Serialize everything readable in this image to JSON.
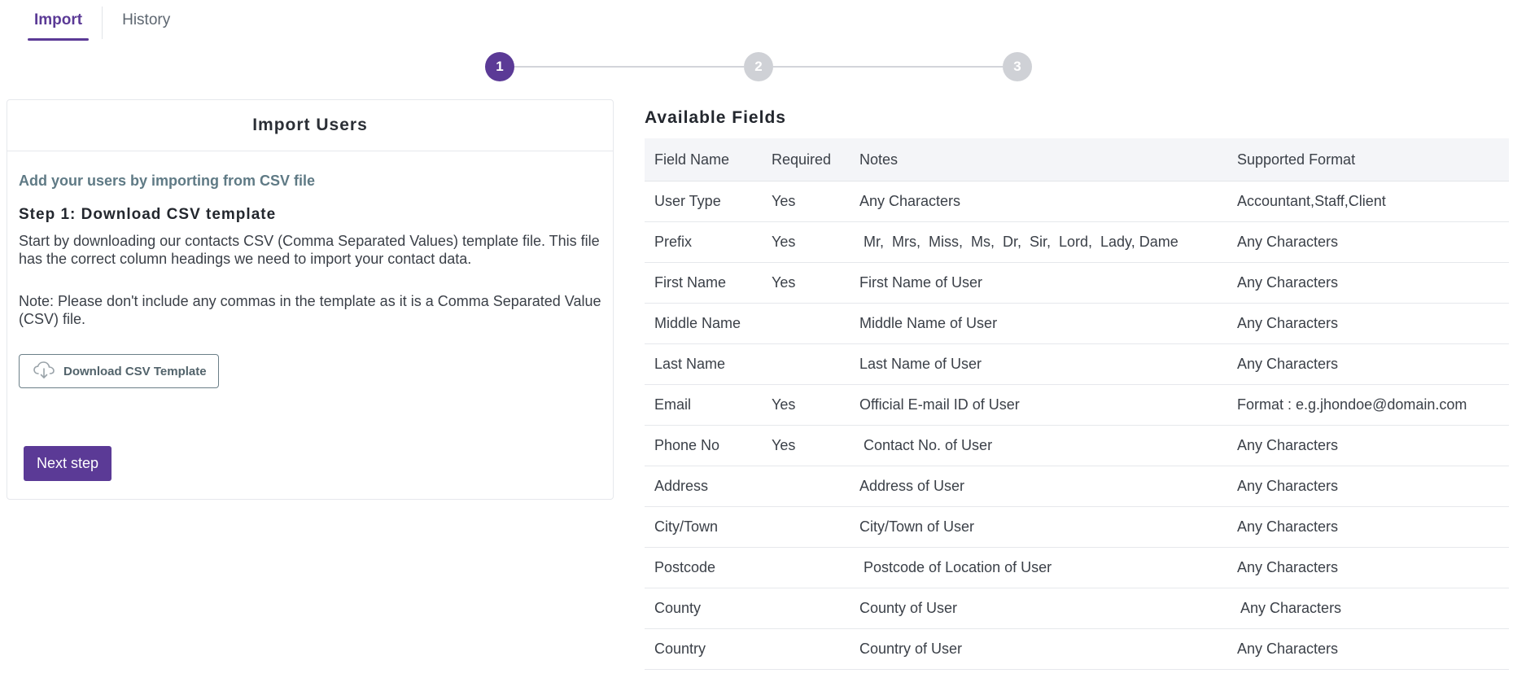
{
  "tabs": [
    {
      "label": "Import",
      "active": true
    },
    {
      "label": "History",
      "active": false
    }
  ],
  "stepper": {
    "steps": [
      "1",
      "2",
      "3"
    ],
    "current": 1
  },
  "card": {
    "title": "Import Users",
    "subtitle": "Add your users by importing from CSV file",
    "step_title": "Step 1: Download CSV template",
    "description": "Start by downloading our contacts CSV (Comma Separated Values) template file. This file has the correct column headings we need to import your contact data.",
    "note": "Note: Please don't include any commas in the template as it is a Comma Separated Value (CSV) file.",
    "download_label": "Download CSV Template",
    "download_icon": "cloud-download-icon",
    "next_label": "Next step"
  },
  "fields": {
    "title": "Available Fields",
    "columns": [
      "Field Name",
      "Required",
      "Notes",
      "Supported Format"
    ],
    "rows": [
      [
        "User Type",
        "Yes",
        "Any Characters",
        "Accountant,Staff,Client"
      ],
      [
        "Prefix",
        "Yes",
        " Mr,  Mrs,  Miss,  Ms,  Dr,  Sir,  Lord,  Lady, Dame",
        "Any Characters"
      ],
      [
        "First Name",
        "Yes",
        "First Name of User",
        "Any Characters"
      ],
      [
        "Middle Name",
        "",
        "Middle Name of User",
        "Any Characters"
      ],
      [
        "Last Name",
        "",
        "Last Name of User",
        "Any Characters"
      ],
      [
        "Email",
        "Yes",
        "Official E-mail ID of User",
        "Format : e.g.jhondoe@domain.com"
      ],
      [
        "Phone No",
        "Yes",
        " Contact No. of User",
        "Any Characters"
      ],
      [
        "Address",
        "",
        "Address of User",
        "Any Characters"
      ],
      [
        "City/Town",
        "",
        "City/Town of User",
        "Any Characters"
      ],
      [
        "Postcode",
        "",
        " Postcode of Location of User",
        "Any Characters"
      ],
      [
        "County",
        "",
        "County of User",
        " Any Characters"
      ],
      [
        "Country",
        "",
        "Country of User",
        "Any Characters"
      ]
    ]
  },
  "colors": {
    "accent": "#5b3a96",
    "inactive_step": "#cfd1d6",
    "subtitle": "#5f7a85"
  }
}
